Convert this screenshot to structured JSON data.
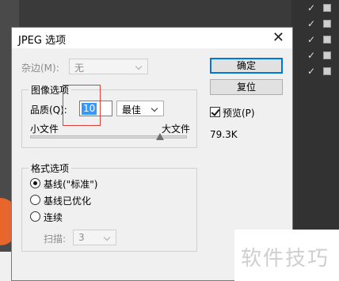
{
  "dialog": {
    "title": "JPEG 选项",
    "matte": {
      "label": "杂边(M):",
      "value": "无"
    },
    "image_options": {
      "group_title": "图像选项",
      "quality_label": "品质(Q):",
      "quality_value": "10",
      "quality_preset": "最佳",
      "small_file_label": "小文件",
      "large_file_label": "大文件",
      "quality_slider_fraction": 0.83
    },
    "format_options": {
      "group_title": "格式选项",
      "radios": [
        {
          "label": "基线(\"标准\")",
          "checked": true
        },
        {
          "label": "基线已优化",
          "checked": false
        },
        {
          "label": "连续",
          "checked": false
        }
      ],
      "scans_label": "扫描:",
      "scans_value": "3"
    },
    "buttons": {
      "ok": "确定",
      "reset": "复位"
    },
    "preview": {
      "label": "预览(P)",
      "checked": true
    },
    "file_size": "79.3K"
  },
  "watermark": "软件技巧",
  "colors": {
    "accent": "#0078d7",
    "highlight": "#3399ff",
    "annotation": "#e0403a",
    "bg_shape": "#e8662b"
  }
}
